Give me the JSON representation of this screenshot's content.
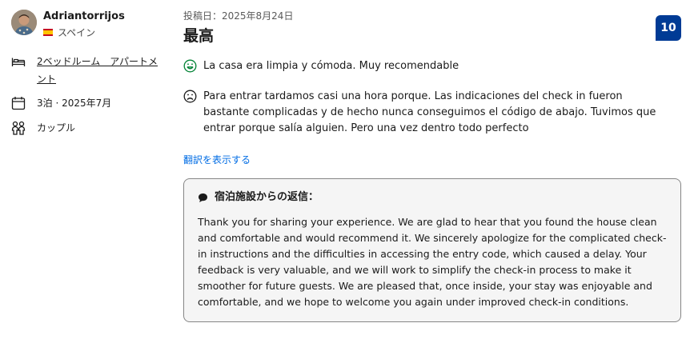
{
  "reviewer": {
    "name": "Adriantorrijos",
    "country": "スペイン"
  },
  "stay": {
    "room": "2ベッドルーム　アパートメント",
    "nights_date": "3泊 · 2025年7月",
    "traveler_type": "カップル"
  },
  "review": {
    "posted": "投稿日：2025年8月24日",
    "title": "最高",
    "score": "10",
    "positive": "La casa era limpia y cómoda. Muy recomendable",
    "negative": "Para entrar tardamos casi una hora porque. Las indicaciones del check in fueron bastante complicadas y de hecho nunca conseguimos el código de abajo. Tuvimos que entrar porque salía alguien. Pero una vez dentro todo perfecto",
    "translate_link": "翻訳を表示する"
  },
  "reply": {
    "heading": "宿泊施設からの返信：",
    "body": "Thank you for sharing your experience. We are glad to hear that you found the house clean and comfortable and would recommend it. We sincerely apologize for the complicated check-in instructions and the difficulties in accessing the entry code, which caused a delay. Your feedback is very valuable, and we will work to simplify the check-in process to make it smoother for future guests. We are pleased that, once inside, your stay was enjoyable and comfortable, and we hope to welcome you again under improved check-in conditions."
  },
  "colors": {
    "score_bg": "#003b95",
    "link": "#006ce4",
    "positive": "#008234",
    "negative": "#1a1a1a"
  },
  "icons": [
    "bed-icon",
    "calendar-icon",
    "people-icon",
    "smile-icon",
    "frown-icon",
    "speech-bubble-icon",
    "spain-flag-icon"
  ]
}
